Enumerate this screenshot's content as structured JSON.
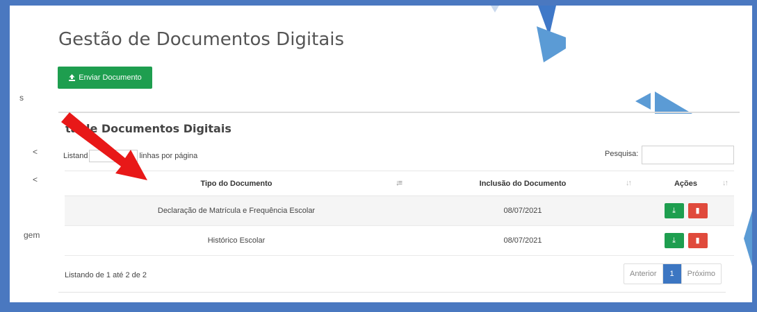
{
  "page": {
    "title": "Gestão de Documentos Digitais"
  },
  "toolbar": {
    "send_label": "Enviar Documento",
    "send_icon": "upload-icon"
  },
  "sidebar_fragments": [
    {
      "text": "s"
    },
    {
      "text": "<"
    },
    {
      "text": "<"
    },
    {
      "text": "gem"
    }
  ],
  "list": {
    "title": "Lista de Documentos Digitais",
    "title_visible": "ta de Documentos Digitais",
    "listing_prefix": "Listand",
    "listing_suffix": "linhas por página",
    "search_label": "Pesquisa:",
    "search_value": "",
    "columns": [
      "Tipo do Documento",
      "Inclusão do Documento",
      "Ações"
    ],
    "rows": [
      {
        "tipo": "Declaração de Matrícula e Frequência Escolar",
        "inclusao": "08/07/2021"
      },
      {
        "tipo": "Histórico Escolar",
        "inclusao": "08/07/2021"
      }
    ],
    "info": "Listando de 1 até 2 de 2",
    "pagination": {
      "prev": "Anterior",
      "current": "1",
      "next": "Próximo"
    }
  },
  "annotation": {
    "type": "red-arrow"
  },
  "colors": {
    "frame": "#4a78c0",
    "success": "#1e9e4f",
    "danger": "#e04a3c",
    "primary": "#3c76c2",
    "decor": "#5b9bd5"
  }
}
